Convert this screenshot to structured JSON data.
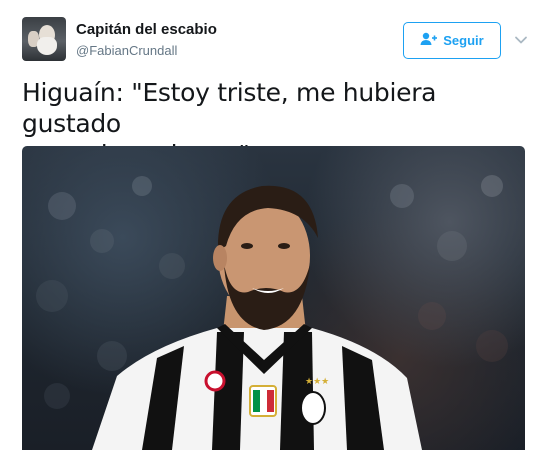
{
  "user": {
    "display_name": "Capitán del escabio",
    "username": "@FabianCrundall",
    "avatar_icon": "avatar-photo"
  },
  "follow_button": {
    "label": "Seguir",
    "icon": "add-user-icon",
    "color": "#1da1f2"
  },
  "menu_icon": "chevron-down-icon",
  "tweet": {
    "text_line1": "Higuaín: \"Estoy triste, me hubiera gustado",
    "text_line2": "ganar la narigona\"."
  },
  "media": {
    "kind": "photo",
    "jersey_stripes": [
      "#000000",
      "#ffffff"
    ]
  }
}
